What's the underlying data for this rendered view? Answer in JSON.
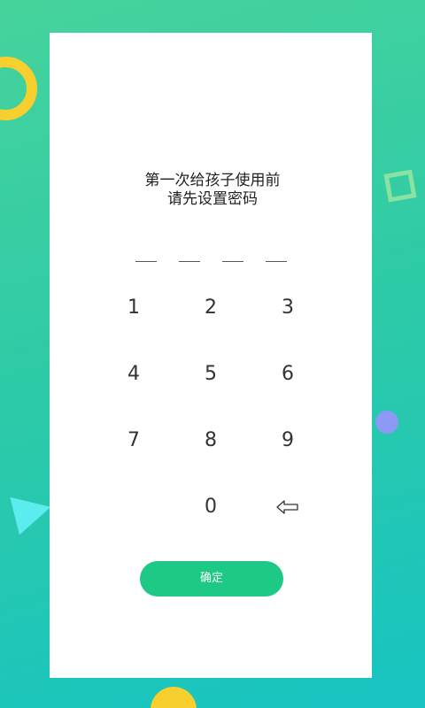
{
  "prompt": {
    "line1": "第一次给孩子使用前",
    "line2": "请先设置密码"
  },
  "pin": {
    "slots": 4,
    "entered": ""
  },
  "keypad": {
    "k1": "1",
    "k2": "2",
    "k3": "3",
    "k4": "4",
    "k5": "5",
    "k6": "6",
    "k7": "7",
    "k8": "8",
    "k9": "9",
    "k0": "0",
    "backspace_icon": "backspace-arrow-icon"
  },
  "confirm": {
    "label": "确定"
  },
  "colors": {
    "background_start": "#46d39c",
    "background_end": "#17c4c2",
    "accent": "#1ec986",
    "ring": "#f7cf2f",
    "dot": "#8c99f5",
    "triangle": "#5cecf0"
  }
}
